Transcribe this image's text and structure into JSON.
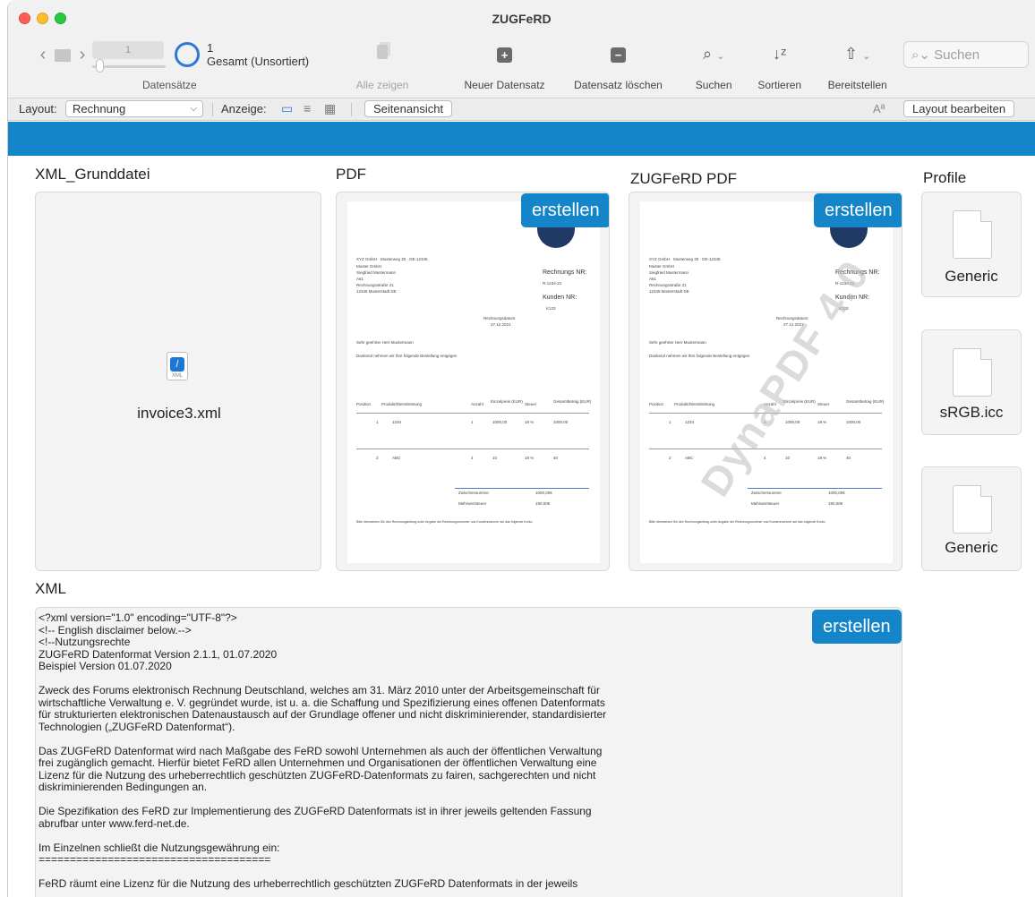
{
  "window": {
    "title": "ZUGFeRD"
  },
  "toolbar": {
    "record_value": "1",
    "record_count": "1",
    "record_total": "Gesamt (Unsortiert)",
    "records_label": "Datensätze",
    "show_all": "Alle zeigen",
    "new_record": "Neuer Datensatz",
    "delete_record": "Datensatz löschen",
    "search": "Suchen",
    "sort": "Sortieren",
    "share": "Bereitstellen",
    "search_placeholder": "Suchen"
  },
  "layoutbar": {
    "layout_label": "Layout:",
    "layout_value": "Rechnung",
    "view_label": "Anzeige:",
    "preview_button": "Seitenansicht",
    "edit_layout_button": "Layout bearbeiten",
    "font_icon_text": "Aª"
  },
  "sections": {
    "xml_base": "XML_Grunddatei",
    "pdf": "PDF",
    "zugferd_pdf": "ZUGFeRD PDF",
    "profile": "Profile",
    "xml": "XML"
  },
  "buttons": {
    "create": "erstellen"
  },
  "xml_file": {
    "name": "invoice3.xml",
    "icon_caption": "XML"
  },
  "profiles": [
    {
      "name": "Generic"
    },
    {
      "name": "sRGB.icc"
    },
    {
      "name": "Generic"
    }
  ],
  "invoice": {
    "sender_line": "XYZ GmbH · Musterweg 30 · DE-12345",
    "recipient": [
      "Muster GmbH",
      "Siegfried Mustermann",
      "A61",
      "Rechnungsstraße  21",
      "12345   Musterstadt   DE"
    ],
    "invoice_no_label": "Rechnungs NR:",
    "invoice_no": "R-1234-21",
    "customer_no_label": "Kunden NR:",
    "customer_no": "K123",
    "date_label": "Rechnungsdatum:",
    "date": "27.12.2021",
    "salutation": "Sehr geehrter Herr  Mustermann",
    "intro": "Dankend nehmen wir Ihre folgende Bestellung entgegen",
    "columns": [
      "Position",
      "Produkt/Dienstleistung",
      "Anzahl",
      "Einzelpreis (EUR)",
      "Steuer",
      "Gesamtbetrag (EUR)"
    ],
    "rows": [
      {
        "pos": "1",
        "product": "1234",
        "qty": "1",
        "price": "1000,00",
        "tax": "19  %",
        "total": "1000,00"
      },
      {
        "pos": "2",
        "product": "ABC",
        "qty": "4",
        "price": "10",
        "tax": "19  %",
        "total": "40"
      }
    ],
    "subtotal_label": "Zwischensumme",
    "subtotal": "1000,00€",
    "vat_label": "Mehrwertsteuer",
    "vat": "190,00€",
    "footer_note": "Bitte überweisen Sie den Rechnungsbetrag unter Angabe der Rechnungsnummer und Kundennummer auf das folgende Konto:",
    "watermark": "DynaPDF 4.0"
  },
  "xml_content": "<?xml version=\"1.0\" encoding=\"UTF-8\"?>\n<!-- English disclaimer below.-->\n<!--Nutzungsrechte\nZUGFeRD Datenformat Version 2.1.1, 01.07.2020\nBeispiel Version 01.07.2020\n\nZweck des Forums elektronisch Rechnung Deutschland, welches am 31. März 2010 unter der Arbeitsgemeinschaft für\nwirtschaftliche Verwaltung e. V. gegründet wurde, ist u. a. die Schaffung und Spezifizierung eines offenen Datenformats\nfür strukturierten elektronischen Datenaustausch auf der Grundlage offener und nicht diskriminierender, standardisierter\nTechnologien („ZUGFeRD Datenformat“).\n\nDas ZUGFeRD Datenformat wird nach Maßgabe des FeRD sowohl Unternehmen als auch der öffentlichen Verwaltung\nfrei zugänglich gemacht. Hierfür bietet FeRD allen Unternehmen und Organisationen der öffentlichen Verwaltung eine\nLizenz für die Nutzung des urheberrechtlich geschützten ZUGFeRD-Datenformats zu fairen, sachgerechten und nicht\ndiskriminierenden Bedingungen an.\n\nDie Spezifikation des FeRD zur Implementierung des ZUGFeRD Datenformats ist in ihrer jeweils geltenden Fassung\nabrufbar unter www.ferd-net.de.\n\nIm Einzelnen schließt die Nutzungsgewährung ein:\n=====================================\n\nFeRD räumt eine Lizenz für die Nutzung des urheberrechtlich geschützten ZUGFeRD Datenformats in der jeweils"
}
